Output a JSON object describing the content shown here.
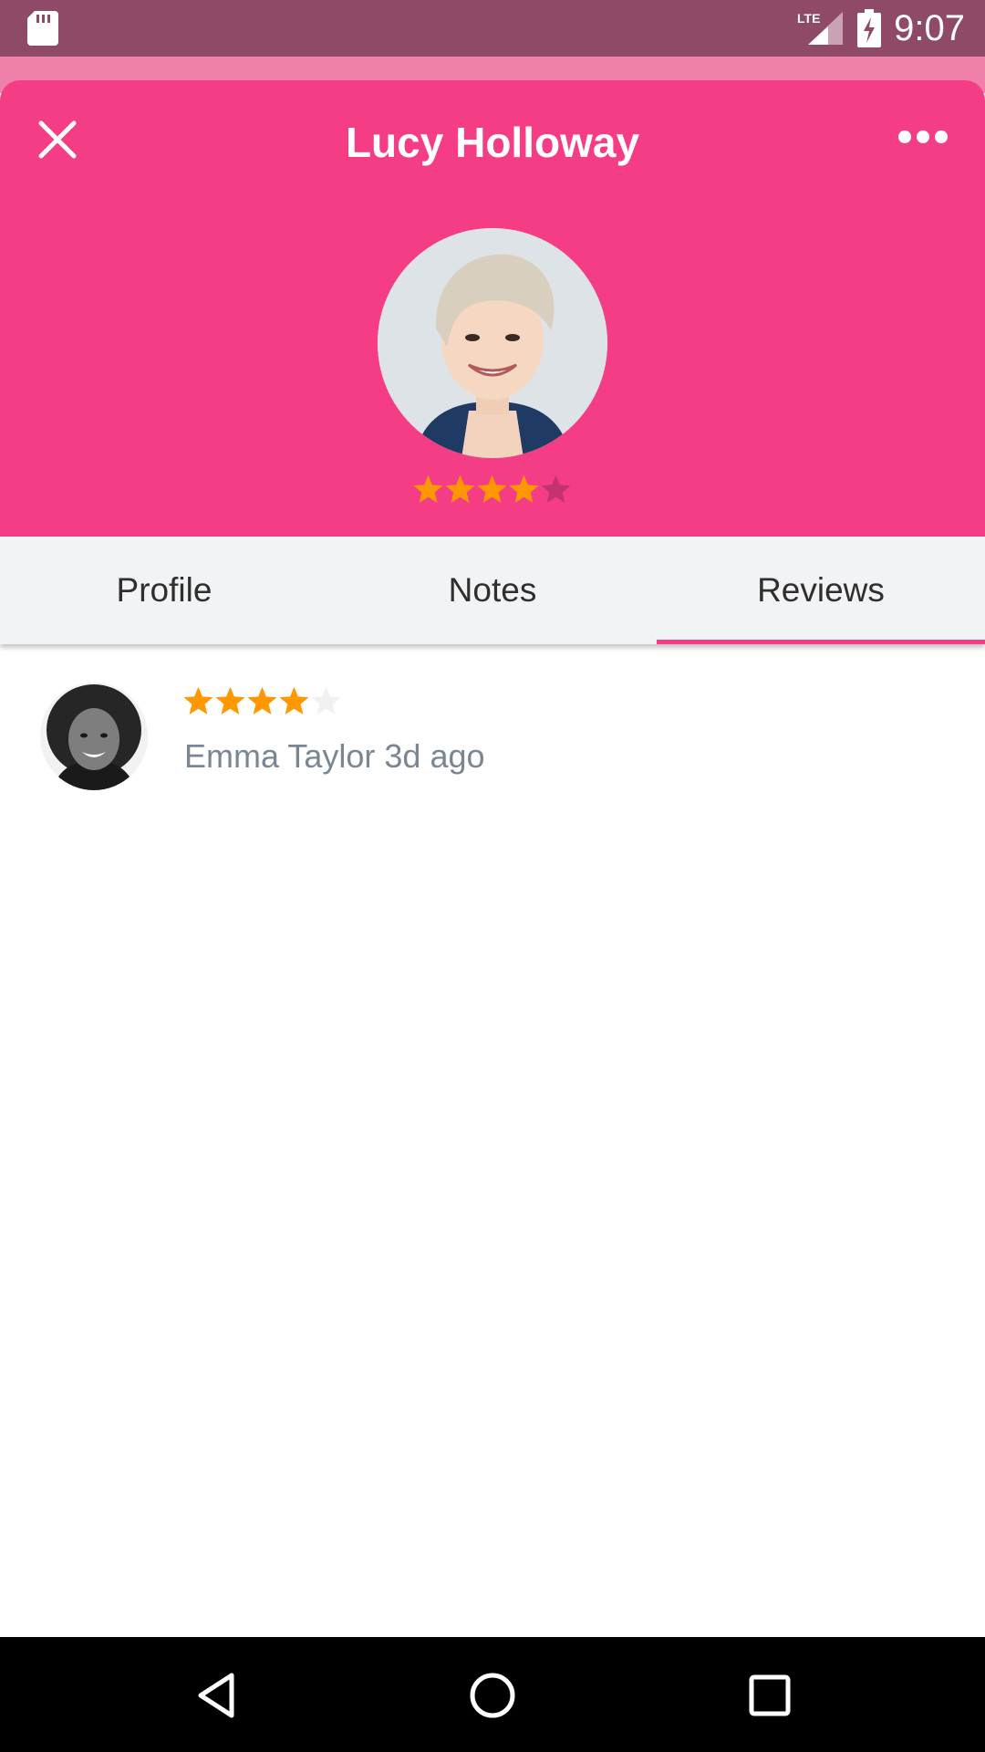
{
  "status_bar": {
    "time": "9:07",
    "network": "LTE",
    "icons": [
      "sd-card-icon",
      "signal-icon",
      "battery-charging-icon"
    ]
  },
  "header": {
    "title": "Lucy Holloway",
    "close_icon": "close-icon",
    "more_icon": "more-horizontal-icon",
    "background_color": "#f53d86"
  },
  "profile": {
    "rating": 4,
    "rating_max": 5
  },
  "tabs": [
    {
      "label": "Profile",
      "active": false
    },
    {
      "label": "Notes",
      "active": false
    },
    {
      "label": "Reviews",
      "active": true
    }
  ],
  "reviews": [
    {
      "author": "Emma Taylor",
      "time": "3d ago",
      "rating": 4,
      "rating_max": 5
    }
  ],
  "colors": {
    "accent": "#f53d86",
    "star_filled": "#ff9800",
    "star_empty_header": "#c2336f",
    "star_empty_list": "#f1f1f1"
  }
}
